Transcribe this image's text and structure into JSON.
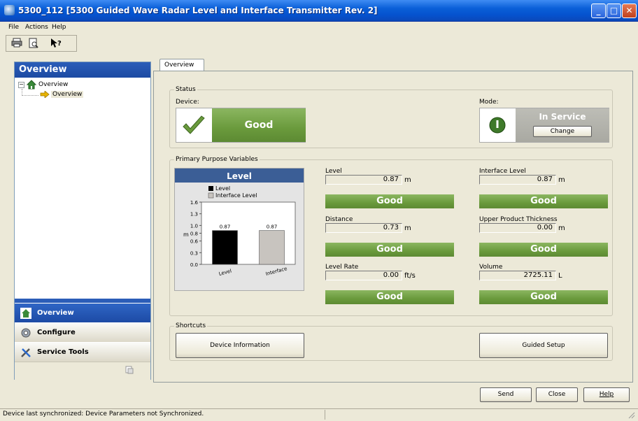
{
  "window": {
    "title": "5300_112 [5300 Guided Wave Radar Level and Interface Transmitter Rev. 2]"
  },
  "menu": {
    "file": "File",
    "actions": "Actions",
    "help": "Help"
  },
  "left_panel": {
    "title": "Overview",
    "tree": {
      "root": "Overview",
      "child": "Overview"
    },
    "nav": [
      {
        "label": "Overview",
        "icon": "home-icon",
        "selected": true
      },
      {
        "label": "Configure",
        "icon": "gear-icon",
        "selected": false
      },
      {
        "label": "Service Tools",
        "icon": "tools-icon",
        "selected": false
      }
    ]
  },
  "tab": {
    "label": "Overview"
  },
  "status": {
    "group_label": "Status",
    "device_label": "Device:",
    "device_value": "Good",
    "mode_label": "Mode:",
    "mode_value": "In Service",
    "change_button": "Change"
  },
  "ppv": {
    "group_label": "Primary Purpose Variables",
    "variables": [
      {
        "label": "Level",
        "value": "0.87",
        "unit": "m",
        "status": "Good"
      },
      {
        "label": "Interface Level",
        "value": "0.87",
        "unit": "m",
        "status": "Good"
      },
      {
        "label": "Distance",
        "value": "0.73",
        "unit": "m",
        "status": "Good"
      },
      {
        "label": "Upper Product Thickness",
        "value": "0.00",
        "unit": "m",
        "status": "Good"
      },
      {
        "label": "Level Rate",
        "value": "0.00",
        "unit": "ft/s",
        "status": "Good"
      },
      {
        "label": "Volume",
        "value": "2725.11",
        "unit": "L",
        "status": "Good"
      }
    ]
  },
  "chart_data": {
    "type": "bar",
    "title": "Level",
    "categories": [
      "Level",
      "Interface"
    ],
    "legend": [
      "Level",
      "Interface Level"
    ],
    "values": [
      0.87,
      0.87
    ],
    "value_labels": [
      "0.87",
      "0.87"
    ],
    "ylabel": "m",
    "ylim": [
      0,
      1.6
    ],
    "yticks": [
      "0.0",
      "0.3",
      "0.6",
      "0.8",
      "1.0",
      "1.3",
      "1.6"
    ],
    "ytick_values": [
      0.0,
      0.3,
      0.6,
      0.8,
      1.0,
      1.3,
      1.6
    ],
    "colors": [
      "#000000",
      "#c8c4bf"
    ]
  },
  "shortcuts": {
    "group_label": "Shortcuts",
    "device_info": "Device Information",
    "guided_setup": "Guided Setup"
  },
  "footer": {
    "send": "Send",
    "close": "Close",
    "help": "Help"
  },
  "statusbar": {
    "text": "Device last synchronized: Device Parameters not Synchronized."
  },
  "colors": {
    "good_green": "#6a9a3c",
    "title_blue": "#0a5fd8",
    "panel_blue": "#2b5db8"
  }
}
